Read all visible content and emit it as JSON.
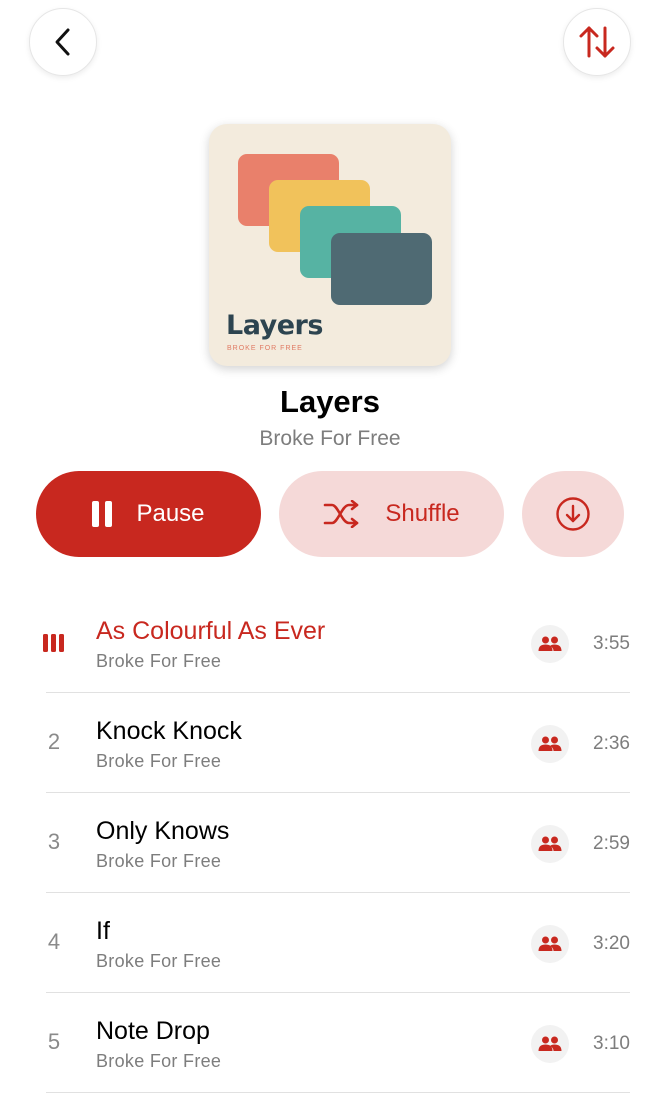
{
  "colors": {
    "accent": "#c8281f",
    "accent_light": "#f5d9d8",
    "secondary_text": "#7d7d7d"
  },
  "header": {
    "back_icon": "chevron-left-icon",
    "sort_icon": "sort-arrows-icon"
  },
  "album": {
    "cover_title": "Layers",
    "cover_subtitle": "BROKE FOR FREE",
    "cover_colors": [
      "#e9806b",
      "#f1c25b",
      "#56b3a3",
      "#4f6a73"
    ],
    "title": "Layers",
    "artist": "Broke For Free"
  },
  "actions": {
    "pause_label": "Pause",
    "shuffle_label": "Shuffle",
    "download_icon": "download-circle-icon"
  },
  "tracks": [
    {
      "number": "",
      "title": "As Colourful As Ever",
      "artist": "Broke For Free",
      "duration": "3:55",
      "playing": true
    },
    {
      "number": "2",
      "title": "Knock Knock",
      "artist": "Broke For Free",
      "duration": "2:36",
      "playing": false
    },
    {
      "number": "3",
      "title": "Only Knows",
      "artist": "Broke For Free",
      "duration": "2:59",
      "playing": false
    },
    {
      "number": "4",
      "title": "If",
      "artist": "Broke For Free",
      "duration": "3:20",
      "playing": false
    },
    {
      "number": "5",
      "title": "Note Drop",
      "artist": "Broke For Free",
      "duration": "3:10",
      "playing": false
    }
  ]
}
